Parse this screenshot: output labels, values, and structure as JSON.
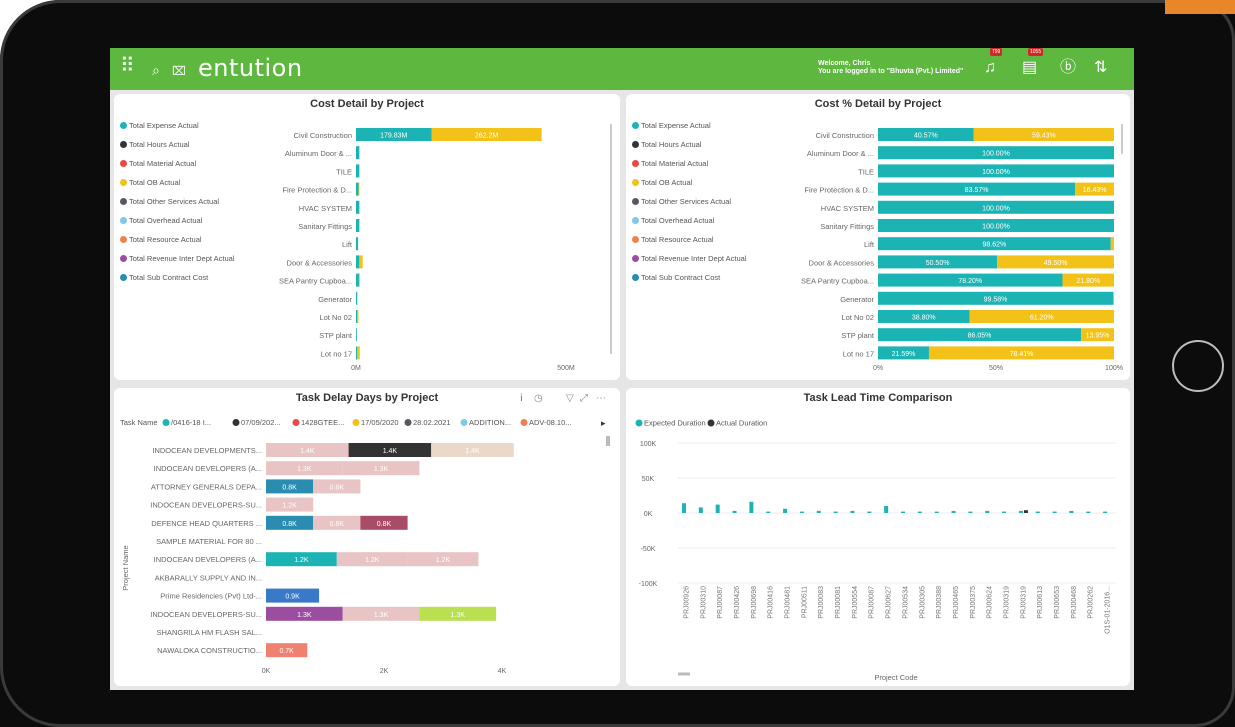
{
  "app": {
    "logo": "entution",
    "welcome_line1": "Welcome, Chris",
    "welcome_line2": "You are logged in to \"Bhuvta (Pvt.) Limited\"",
    "notif_badge_1": "799",
    "notif_badge_2": "1055"
  },
  "colors": {
    "topbar": "#5eb73e",
    "teal": "#1bb3b3",
    "yellow": "#f2c218"
  },
  "cost_legend": [
    {
      "label": "Total Expense Actual",
      "color": "#1bb3b3"
    },
    {
      "label": "Total Hours Actual",
      "color": "#333333"
    },
    {
      "label": "Total Material Actual",
      "color": "#e84848"
    },
    {
      "label": "Total OB Actual",
      "color": "#f2c218"
    },
    {
      "label": "Total Other Services Actual",
      "color": "#555a60"
    },
    {
      "label": "Total Overhead Actual",
      "color": "#7ec8e8"
    },
    {
      "label": "Total Resource Actual",
      "color": "#f08050"
    },
    {
      "label": "Total Revenue Inter Dept Actual",
      "color": "#9b4da0"
    },
    {
      "label": "Total Sub Contract Cost",
      "color": "#2a8cb0"
    }
  ],
  "chart_data": [
    {
      "type": "bar",
      "title": "Cost Detail by Project",
      "orientation": "horizontal",
      "stacked": true,
      "categories": [
        "Civil Construction",
        "Aluminum Door & ...",
        "TILE",
        "Fire Protection & D...",
        "HVAC SYSTEM",
        "Sanitary Fittings",
        "Lift",
        "Door & Accessories",
        "SEA Pantry Cupboa...",
        "Generator",
        "Lot No 02",
        "STP plant",
        "Lot no 17"
      ],
      "series": [
        {
          "name": "Total Expense Actual",
          "values": [
            179.83,
            8,
            8,
            6,
            8,
            8,
            5,
            8,
            7,
            3,
            3,
            2,
            3
          ]
        },
        {
          "name": "Total OB Actual",
          "values": [
            262.2,
            0,
            0,
            2,
            0,
            0,
            0,
            8,
            2,
            0,
            3,
            0,
            6
          ]
        }
      ],
      "data_labels": [
        "179.83M",
        "262.2M"
      ],
      "xlim": [
        0,
        500
      ],
      "x_ticks": [
        "0M",
        "500M"
      ],
      "unit": "M"
    },
    {
      "type": "bar",
      "title": "Cost % Detail by Project",
      "orientation": "horizontal",
      "stacked": true,
      "categories": [
        "Civil Construction",
        "Aluminum Door & ...",
        "TILE",
        "Fire Protection & D...",
        "HVAC SYSTEM",
        "Sanitary Fittings",
        "Lift",
        "Door & Accessories",
        "SEA Pantry Cupboa...",
        "Generator",
        "Lot No 02",
        "STP plant",
        "Lot no 17"
      ],
      "series": [
        {
          "name": "Total Expense Actual",
          "values": [
            40.57,
            100.0,
            100.0,
            83.57,
            100.0,
            100.0,
            98.62,
            50.5,
            78.2,
            99.58,
            38.8,
            86.05,
            21.59
          ]
        },
        {
          "name": "Total OB Actual",
          "values": [
            59.43,
            0,
            0,
            16.43,
            0,
            0,
            1.38,
            49.5,
            21.8,
            0.42,
            61.2,
            13.95,
            78.41
          ]
        }
      ],
      "labels_a": [
        "40.57%",
        "100.00%",
        "100.00%",
        "83.57%",
        "100.00%",
        "100.00%",
        "98.62%",
        "50.50%",
        "78.20%",
        "99.58%",
        "38.80%",
        "86.05%",
        "21.59%"
      ],
      "labels_b": [
        "59.43%",
        "",
        "",
        "16.43%",
        "",
        "",
        "",
        "49.50%",
        "21.80%",
        "",
        "61.20%",
        "13.95%",
        "78.41%"
      ],
      "xlim": [
        0,
        100
      ],
      "x_ticks": [
        "0%",
        "50%",
        "100%"
      ]
    },
    {
      "type": "bar",
      "title": "Task Delay Days by Project",
      "orientation": "horizontal",
      "stacked": true,
      "legend_title": "Task Name",
      "legend": [
        {
          "label": "/0416-18 I...",
          "color": "#1bb3b3"
        },
        {
          "label": "07/09/202...",
          "color": "#333333"
        },
        {
          "label": "1428GTEE...",
          "color": "#e84848"
        },
        {
          "label": "17/05/2020",
          "color": "#f2c218"
        },
        {
          "label": "28.02.2021",
          "color": "#555a60"
        },
        {
          "label": "ADDITION...",
          "color": "#7ec8e8"
        },
        {
          "label": "ADV-08.10...",
          "color": "#f08050"
        }
      ],
      "ylabel": "Project Name",
      "categories": [
        "INDOCEAN DEVELOPMENTS...",
        "INDOCEAN DEVELOPERS (A...",
        "ATTORNEY GENERALS DEPA...",
        "INDOCEAN DEVELOPERS-SU...",
        "DEFENCE HEAD QUARTERS ...",
        "SAMPLE MATERIAL FOR 80 ...",
        "INDOCEAN DEVELOPERS (A...",
        "AKBARALLY SUPPLY AND IN...",
        "Prime Residencies (Pvt) Ltd-...",
        "INDOCEAN DEVELOPERS-SU...",
        "SHANGRILA HM FLASH SAL...",
        "NAWALOKA CONSTRUCTIO..."
      ],
      "rows": [
        [
          {
            "v": 1.4,
            "c": "#e8c4c4",
            "t": "1.4K"
          },
          {
            "v": 1.4,
            "c": "#333333",
            "t": "1.4K"
          },
          {
            "v": 1.4,
            "c": "#ead8c8",
            "t": "1.4K"
          }
        ],
        [
          {
            "v": 1.3,
            "c": "#e8c4c4",
            "t": "1.3K"
          },
          {
            "v": 1.3,
            "c": "#e8c4c4",
            "t": "1.3K"
          }
        ],
        [
          {
            "v": 0.8,
            "c": "#2a8cb0",
            "t": "0.8K"
          },
          {
            "v": 0.8,
            "c": "#e8c4c4",
            "t": "0.8K"
          }
        ],
        [
          {
            "v": 0.8,
            "c": "#e8c4c4",
            "t": "1.2K"
          }
        ],
        [
          {
            "v": 0.8,
            "c": "#2a8cb0",
            "t": "0.8K"
          },
          {
            "v": 0.8,
            "c": "#e8c4c4",
            "t": "0.8K"
          },
          {
            "v": 0.8,
            "c": "#a84c68",
            "t": "0.8K"
          }
        ],
        [],
        [
          {
            "v": 1.2,
            "c": "#1bb3b3",
            "t": "1.2K"
          },
          {
            "v": 1.2,
            "c": "#e8c4c4",
            "t": "1.2K"
          },
          {
            "v": 1.2,
            "c": "#e8c4c4",
            "t": "1.2K"
          }
        ],
        [],
        [
          {
            "v": 0.9,
            "c": "#3a78c8",
            "t": "0.9K"
          }
        ],
        [
          {
            "v": 1.3,
            "c": "#9b4da0",
            "t": "1.3K"
          },
          {
            "v": 1.3,
            "c": "#e8c4c4",
            "t": "1.3K"
          },
          {
            "v": 1.3,
            "c": "#b8e050",
            "t": "1.3K"
          }
        ],
        [],
        [
          {
            "v": 0.7,
            "c": "#f08070",
            "t": "0.7K"
          }
        ]
      ],
      "xlim": [
        0,
        4.5
      ],
      "x_ticks": [
        "0K",
        "2K",
        "4K"
      ]
    },
    {
      "type": "bar",
      "title": "Task Lead Time Comparison",
      "legend": [
        {
          "label": "Expected Duration",
          "color": "#1bb3b3"
        },
        {
          "label": "Actual Duration",
          "color": "#333333"
        }
      ],
      "xlabel": "Project Code",
      "categories": [
        "PRJ00926",
        "PRJ00310",
        "PRJ00087",
        "PRJ00426",
        "PRJ00698",
        "PRJ00416",
        "PRJ00481",
        "PRJ00511",
        "PRJ00083",
        "PRJ00081",
        "PRJ00554",
        "PRJ00087",
        "PRJ00627",
        "PRJ00534",
        "PRJ00305",
        "PRJ00388",
        "PRJ00465",
        "PRJ00375",
        "PRJ00624",
        "PRJ00319",
        "PRJ00319",
        "PRJ00613",
        "PRJ00653",
        "PRJ00468",
        "PRJ00262",
        "O1S-01-2016..."
      ],
      "series": [
        {
          "name": "Expected Duration",
          "values": [
            14000,
            8000,
            12000,
            3000,
            16000,
            2000,
            6000,
            2000,
            3000,
            2000,
            3000,
            2000,
            10000,
            2000,
            2000,
            2000,
            3000,
            2000,
            3000,
            2000,
            3000,
            2000,
            2000,
            3000,
            2000,
            2000
          ]
        },
        {
          "name": "Actual Duration",
          "values": [
            0,
            0,
            0,
            0,
            0,
            0,
            0,
            0,
            0,
            0,
            0,
            0,
            0,
            0,
            0,
            0,
            0,
            0,
            0,
            0,
            4000,
            0,
            0,
            0,
            0,
            0
          ]
        }
      ],
      "ylim": [
        -100000,
        100000
      ],
      "y_ticks": [
        "100K",
        "50K",
        "0K",
        "-50K",
        "-100K"
      ]
    }
  ]
}
